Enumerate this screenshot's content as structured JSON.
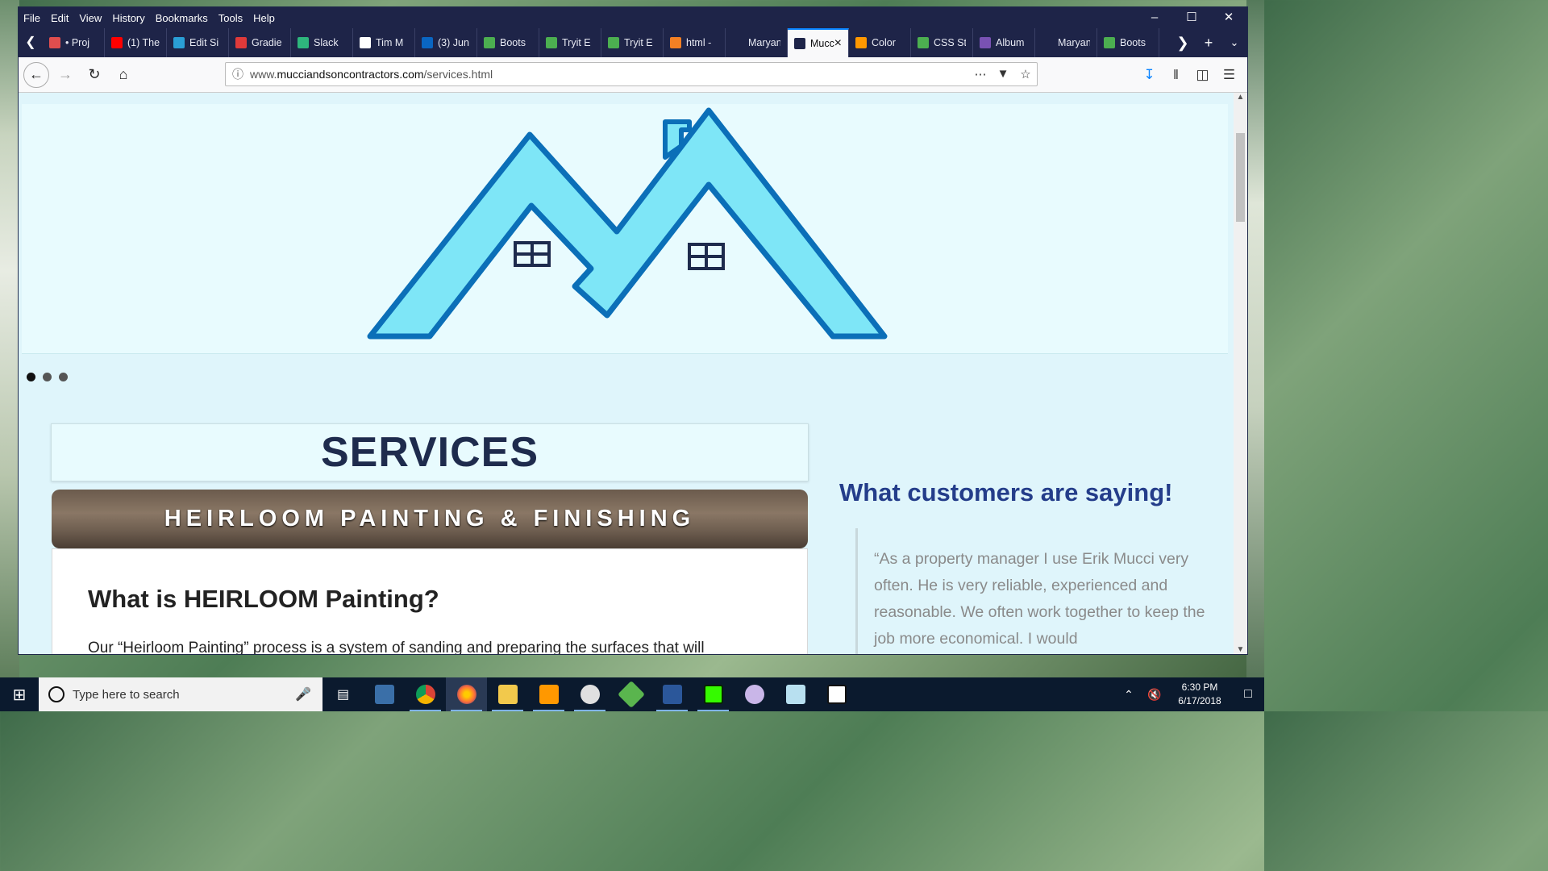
{
  "menu": [
    "File",
    "Edit",
    "View",
    "History",
    "Bookmarks",
    "Tools",
    "Help"
  ],
  "tabs": [
    {
      "label": "• Proj",
      "color": "#e04e4e"
    },
    {
      "label": "(1) The",
      "color": "#ff0000"
    },
    {
      "label": "Edit Si",
      "color": "#2a9fd6"
    },
    {
      "label": "Gradie",
      "color": "#e03a3a"
    },
    {
      "label": "Slack",
      "color": "#2eb67d"
    },
    {
      "label": "Tim M",
      "color": "#ffffff"
    },
    {
      "label": "(3) Jun",
      "color": "#0a66c2"
    },
    {
      "label": "Boots",
      "color": "#4caf50"
    },
    {
      "label": "Tryit E",
      "color": "#4caf50"
    },
    {
      "label": "Tryit E",
      "color": "#4caf50"
    },
    {
      "label": "html -",
      "color": "#f48024"
    },
    {
      "label": "Maryann Jc",
      "color": "#1e2448"
    },
    {
      "label": "Mucci",
      "color": "#1e2448",
      "active": true
    },
    {
      "label": "Color",
      "color": "#ff9800"
    },
    {
      "label": "CSS St",
      "color": "#4caf50"
    },
    {
      "label": "Album",
      "color": "#7952b3"
    },
    {
      "label": "Maryann Jc",
      "color": "#1e2448"
    },
    {
      "label": "Boots",
      "color": "#4caf50"
    }
  ],
  "url": {
    "prefix": "www.",
    "domain": "mucciandsoncontractors.com",
    "path": "/services.html"
  },
  "page": {
    "services_title": "SERVICES",
    "banner": "HEIRLOOM PAINTING & FINISHING",
    "card_heading": "What is HEIRLOOM Painting?",
    "card_text": "Our “Heirloom Painting” process is a system of sanding and preparing the surfaces that will",
    "customers_title": "What customers are saying!",
    "quote": "“As a property manager I use Erik Mucci very often. He is very reliable, experienced and reasonable. We often work together to keep the job more economical. I would"
  },
  "taskbar": {
    "search_placeholder": "Type here to search",
    "time": "6:30 PM",
    "date": "6/17/2018"
  },
  "colors": {
    "roof_fill": "#7ee6f7",
    "roof_stroke": "#0b6fb8",
    "title_navy": "#1e2b4d",
    "accent_blue": "#243d8a"
  }
}
